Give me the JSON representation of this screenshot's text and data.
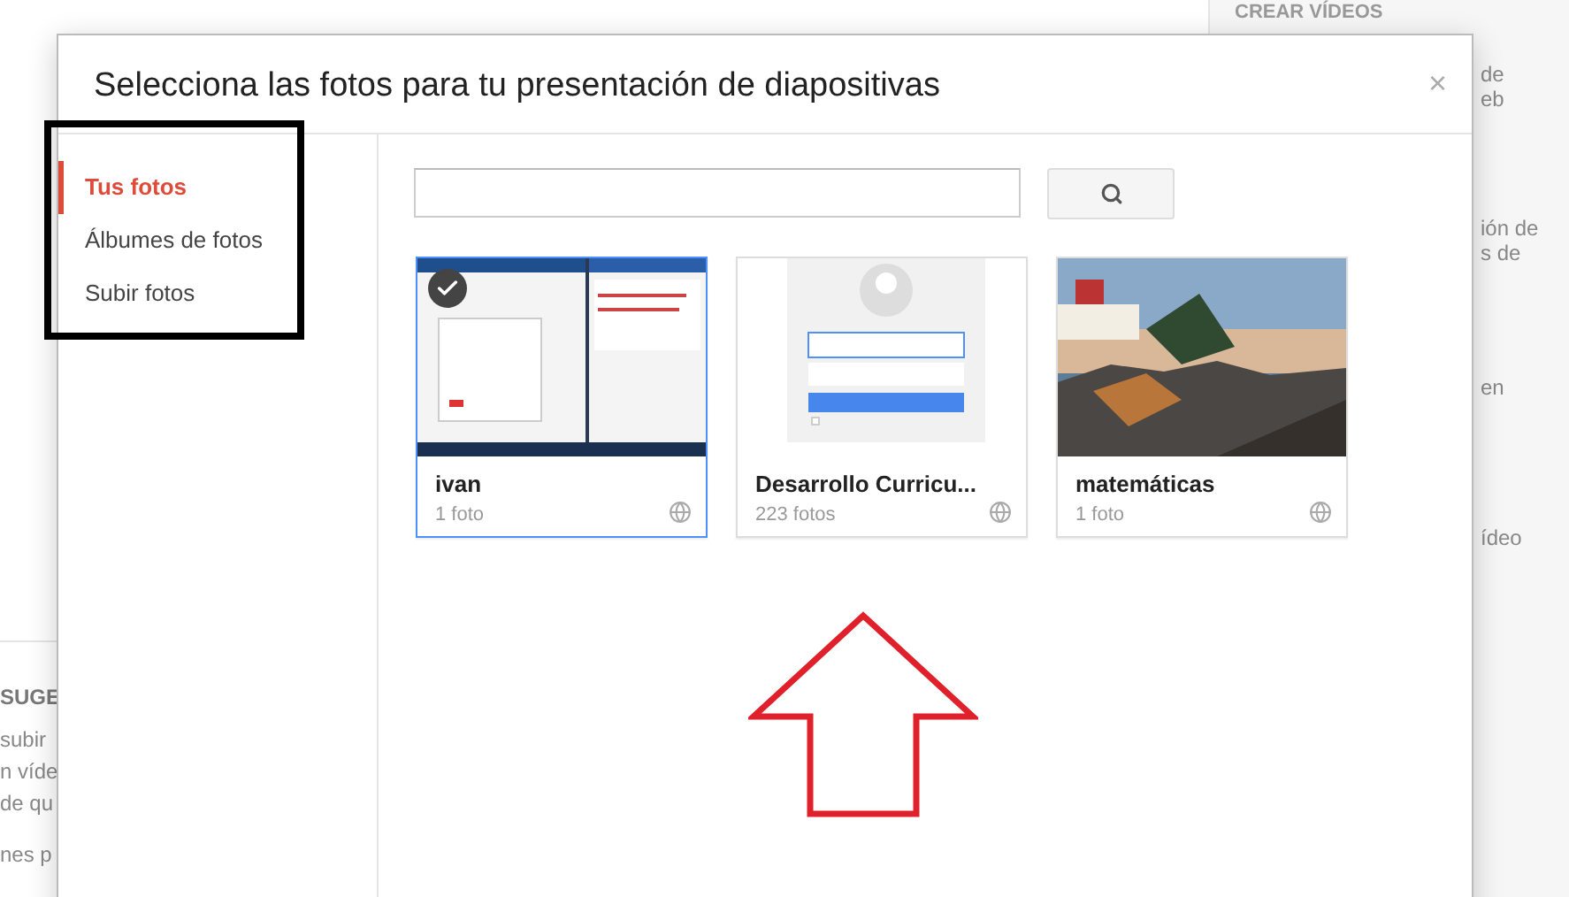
{
  "background": {
    "right_heading": "CREAR VÍDEOS",
    "right_texts": [
      "de",
      "eb",
      "ión de",
      "s de",
      "en",
      "ídeo"
    ],
    "left_heading": "SUGE",
    "left_texts": [
      "subir",
      "n víde",
      "de qu",
      "nes p"
    ]
  },
  "dialog": {
    "title": "Selecciona las fotos para tu presentación de diapositivas",
    "close": "×",
    "sidebar": [
      {
        "label": "Tus fotos",
        "selected": true
      },
      {
        "label": "Álbumes de fotos",
        "selected": false
      },
      {
        "label": "Subir fotos",
        "selected": false
      }
    ],
    "albums": [
      {
        "title": "ivan",
        "count": "1 foto",
        "selected": true,
        "kind": "picture"
      },
      {
        "title": "Desarrollo Curricu...",
        "count": "223 fotos",
        "selected": false,
        "kind": "picture"
      },
      {
        "title": "matemáticas",
        "count": "1 foto",
        "selected": false,
        "kind": "picture"
      }
    ]
  }
}
